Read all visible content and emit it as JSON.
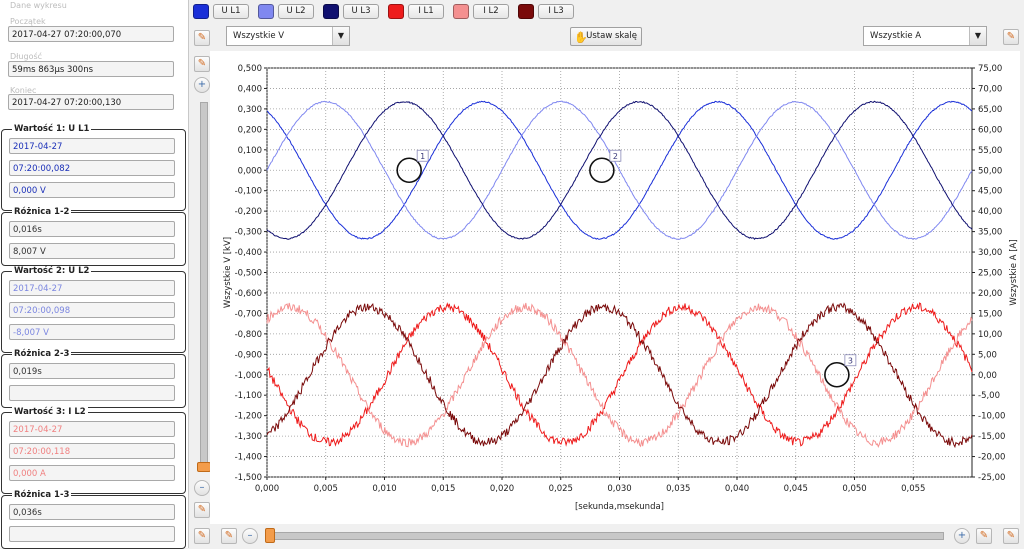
{
  "left_panel": {
    "header": "Dane wykresu",
    "start_label": "Początek",
    "start_value": "2017-04-27 07:20:00,070",
    "length_label": "Długość",
    "length_value": "59ms 863µs 300ns",
    "end_label": "Koniec",
    "end_value": "2017-04-27 07:20:00,130",
    "groups": [
      {
        "title": "Wartość 1: U L1",
        "fields": [
          "2017-04-27",
          "07:20:00,082",
          "0,000 V"
        ],
        "color": "#1a2fb8"
      },
      {
        "title": "Różnica 1-2",
        "fields": [
          "0,016s",
          "8,007 V"
        ],
        "color": "#333333"
      },
      {
        "title": "Wartość 2: U L2",
        "fields": [
          "2017-04-27",
          "07:20:00,098",
          "-8,007 V"
        ],
        "color": "#7b86e0"
      },
      {
        "title": "Różnica 2-3",
        "fields": [
          "0,019s",
          ""
        ],
        "color": "#333333"
      },
      {
        "title": "Wartość 3: I L2",
        "fields": [
          "2017-04-27",
          "07:20:00,118",
          "0,000 A"
        ],
        "color": "#f08080"
      },
      {
        "title": "Różnica 1-3",
        "fields": [
          "0,036s",
          ""
        ],
        "color": "#333333"
      }
    ]
  },
  "legend": [
    {
      "label": "U L1",
      "color": "#1a2fd8"
    },
    {
      "label": "U L2",
      "color": "#8088f0"
    },
    {
      "label": "U L3",
      "color": "#101070"
    },
    {
      "label": "I L1",
      "color": "#ee1c1c"
    },
    {
      "label": "I L2",
      "color": "#f49090"
    },
    {
      "label": "I L3",
      "color": "#7a0a0a"
    }
  ],
  "toolbar": {
    "voltage_select": "Wszystkie V",
    "current_select": "Wszystkie A",
    "scale_button": "Ustaw skalę"
  },
  "icons": {
    "tool": "pencil-square-icon",
    "zoom_in": "zoom-in-icon",
    "zoom_out": "zoom-out-icon",
    "scale": "scale-hand-icon"
  },
  "chart_data": {
    "type": "line",
    "xlabel": "[sekunda,msekunda]",
    "ylabel_left": "Wszystkie V [kV]",
    "ylabel_right": "Wszystkie A [A]",
    "xlim": [
      0,
      0.06
    ],
    "ylim_left": [
      -1.5,
      0.5
    ],
    "ylim_right": [
      -25,
      75
    ],
    "x_ticks": [
      "0,000",
      "0,005",
      "0,010",
      "0,015",
      "0,020",
      "0,025",
      "0,030",
      "0,035",
      "0,040",
      "0,045",
      "0,050",
      "0,055"
    ],
    "y_ticks_left": [
      "0,500",
      "0,400",
      "0,300",
      "0,200",
      "0,100",
      "0,000",
      "-0,100",
      "-0,200",
      "-0,300",
      "-0,400",
      "-0,500",
      "-0,600",
      "-0,700",
      "-0,800",
      "-0,900",
      "-1,000",
      "-1,100",
      "-1,200",
      "-1,300",
      "-1,400",
      "-1,500"
    ],
    "y_ticks_right": [
      "75,00",
      "70,00",
      "65,00",
      "60,00",
      "55,00",
      "50,00",
      "45,00",
      "40,00",
      "35,00",
      "30,00",
      "25,00",
      "20,00",
      "15,00",
      "10,00",
      "5,00",
      "0,00",
      "-5,00",
      "-10,00",
      "-15,00",
      "-20,00",
      "-25,00"
    ],
    "grid": true,
    "series": [
      {
        "name": "U L1",
        "axis": "left",
        "amplitude": 0.335,
        "offset": 0,
        "phase_deg": 120,
        "frequency_hz": 50
      },
      {
        "name": "U L2",
        "axis": "left",
        "amplitude": 0.335,
        "offset": 0,
        "phase_deg": 0,
        "frequency_hz": 50
      },
      {
        "name": "U L3",
        "axis": "left",
        "amplitude": 0.335,
        "offset": 0,
        "phase_deg": -120,
        "frequency_hz": 50
      },
      {
        "name": "I L1",
        "axis": "right",
        "amplitude": 16.5,
        "offset": 0,
        "phase_deg": 175,
        "frequency_hz": 50
      },
      {
        "name": "I L2",
        "axis": "right",
        "amplitude": 16.5,
        "offset": 0,
        "phase_deg": 55,
        "frequency_hz": 50
      },
      {
        "name": "I L3",
        "axis": "right",
        "amplitude": 16.5,
        "offset": 0,
        "phase_deg": -65,
        "frequency_hz": 50
      }
    ],
    "markers": [
      {
        "label": "1",
        "x": 0.0121,
        "y": 0.0,
        "axis": "left"
      },
      {
        "label": "2",
        "x": 0.0285,
        "y": 0.0,
        "axis": "left"
      },
      {
        "label": "3",
        "x": 0.0485,
        "y": 0.0,
        "axis": "right"
      }
    ]
  }
}
